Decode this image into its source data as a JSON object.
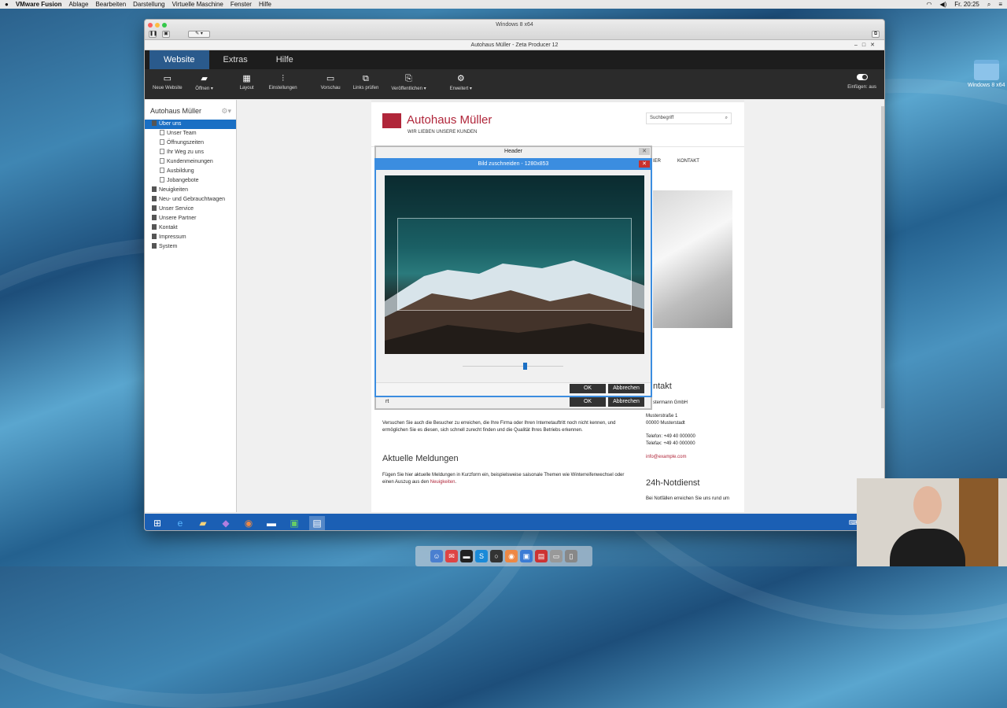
{
  "mac_menubar": {
    "app": "VMware Fusion",
    "items": [
      "Ablage",
      "Bearbeiten",
      "Darstellung",
      "Virtuelle Maschine",
      "Fenster",
      "Hilfe"
    ],
    "clock": "Fr. 20:25"
  },
  "desktop_icon": {
    "label": "Windows 8 x64"
  },
  "vm_window": {
    "title": "Windows 8 x64"
  },
  "app": {
    "title": "Autohaus Müller - Zeta Producer 12",
    "tabs": [
      "Website",
      "Extras",
      "Hilfe"
    ],
    "ribbon": {
      "new_website": "Neue Website",
      "open": "Öffnen ▾",
      "layout": "Layout",
      "settings": "Einstellungen",
      "preview": "Vorschau",
      "links": "Links prüfen",
      "publish": "Veröffentlichen ▾",
      "advanced": "Erweitert ▾",
      "paste": "Einfügen: aus"
    }
  },
  "sidebar": {
    "title": "Autohaus Müller",
    "items": [
      {
        "label": "Über uns",
        "level": 0,
        "selected": true
      },
      {
        "label": "Unser Team",
        "level": 1
      },
      {
        "label": "Öffnungszeiten",
        "level": 1
      },
      {
        "label": "Ihr Weg zu uns",
        "level": 1
      },
      {
        "label": "Kundenmeinungen",
        "level": 1
      },
      {
        "label": "Ausbildung",
        "level": 1
      },
      {
        "label": "Jobangebote",
        "level": 1
      },
      {
        "label": "Neuigkeiten",
        "level": 0
      },
      {
        "label": "Neu- und Gebrauchtwagen",
        "level": 0
      },
      {
        "label": "Unser Service",
        "level": 0
      },
      {
        "label": "Unsere Partner",
        "level": 0
      },
      {
        "label": "Kontakt",
        "level": 0
      },
      {
        "label": "Impressum",
        "level": 0
      },
      {
        "label": "System",
        "level": 0
      }
    ]
  },
  "site": {
    "brand": "Autohaus Müller",
    "tagline": "WIR LIEBEN UNSERE KUNDEN",
    "search_placeholder": "Suchbegriff",
    "nav_partial": "IER",
    "nav_contact": "KONTAKT",
    "para1": "Versuchen Sie auch die Besucher zu erreichen, die Ihre Firma oder Ihren Internetauftritt noch nicht kennen, und ermöglichen Sie es diesen, sich schnell zurecht finden und die Qualität Ihres Betriebs erkennen.",
    "news_heading": "Aktuelle Meldungen",
    "news_text": "Fügen Sie hier aktuelle Meldungen in Kurzform ein, beispielsweise saisonale Themen wie Winterreifenwechsel oder einen Auszug aus den",
    "news_link": "Neuigkeiten",
    "news_end": ".",
    "contact_heading": "ntakt",
    "contact_company": "stermann GmbH",
    "contact_street": "Musterstraße 1",
    "contact_city": "00000 Musterstadt",
    "contact_phone": "Telefon: +49 40 000000",
    "contact_fax": "Telefax: +49 40 000000",
    "contact_email": "info@example.com",
    "emergency_heading": "24h-Notdienst",
    "emergency_text": "Bei Notfällen erreichen Sie uns rund um"
  },
  "header_dialog": {
    "title": "Header",
    "partial": "rt",
    "ok": "OK",
    "cancel": "Abbrechen"
  },
  "crop_dialog": {
    "title": "Bild zuschneiden - 1280x853",
    "ok": "OK",
    "cancel": "Abbrechen",
    "zoom_level": 0.62
  }
}
